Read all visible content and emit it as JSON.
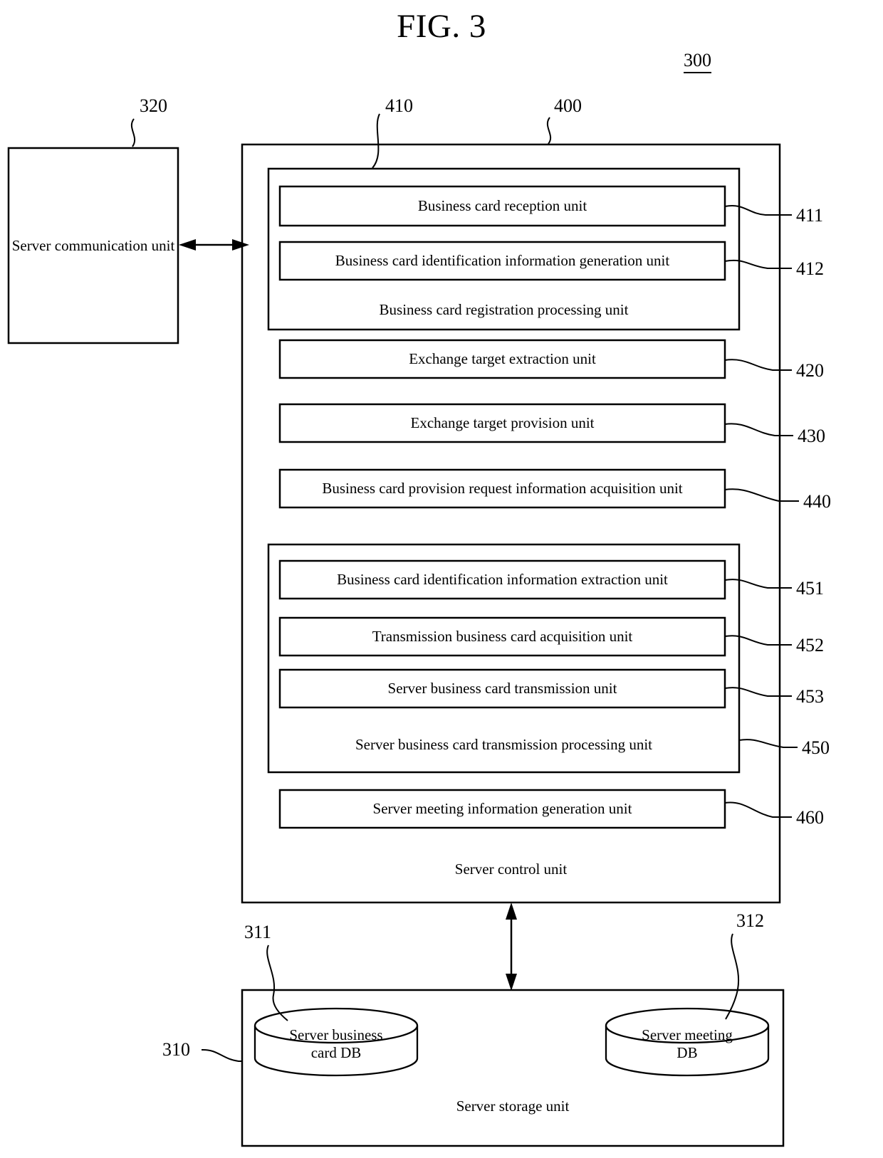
{
  "figure": {
    "title": "FIG. 3",
    "system_ref": "300"
  },
  "communication": {
    "label": "Server communication unit",
    "ref": "320"
  },
  "control_unit": {
    "label": "Server control unit",
    "ref": "400"
  },
  "registration_group": {
    "label": "Business card registration processing unit",
    "ref": "410",
    "items": [
      {
        "label": "Business card reception unit",
        "ref": "411"
      },
      {
        "label": "Business card identification information generation unit",
        "ref": "412"
      }
    ]
  },
  "standalone_units": [
    {
      "label": "Exchange target extraction unit",
      "ref": "420"
    },
    {
      "label": "Exchange target provision unit",
      "ref": "430"
    },
    {
      "label": "Business card provision request information acquisition unit",
      "ref": "440"
    }
  ],
  "transmission_group": {
    "label": "Server business card transmission processing unit",
    "ref": "450",
    "items": [
      {
        "label": "Business card identification information extraction unit",
        "ref": "451"
      },
      {
        "label": "Transmission business card acquisition unit",
        "ref": "452"
      },
      {
        "label": "Server business card transmission unit",
        "ref": "453"
      }
    ]
  },
  "meeting_unit": {
    "label": "Server meeting information generation unit",
    "ref": "460"
  },
  "storage_unit": {
    "label": "Server storage unit",
    "ref": "310",
    "databases": [
      {
        "label_line1": "Server business",
        "label_line2": "card DB",
        "ref": "311"
      },
      {
        "label_line1": "Server meeting",
        "label_line2": "DB",
        "ref": "312"
      }
    ]
  },
  "colors": {
    "stroke": "#000000",
    "background": "#ffffff"
  }
}
